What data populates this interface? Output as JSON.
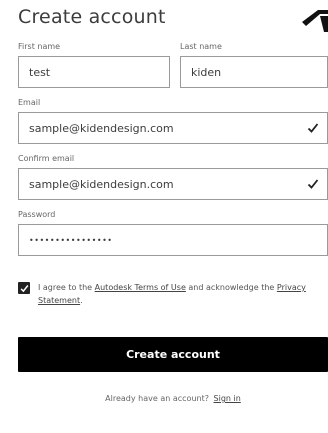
{
  "header": {
    "title": "Create account",
    "logo_icon": "autodesk-logo-icon"
  },
  "form": {
    "first_name": {
      "label": "First name",
      "value": "test"
    },
    "last_name": {
      "label": "Last name",
      "value": "kiden"
    },
    "email": {
      "label": "Email",
      "value": "sample@kidendesign.com",
      "valid_icon": "checkmark-icon"
    },
    "confirm_email": {
      "label": "Confirm email",
      "value": "sample@kidendesign.com",
      "valid_icon": "checkmark-icon"
    },
    "password": {
      "label": "Password",
      "value": "••••••••••••••••"
    }
  },
  "agreement": {
    "checked": true,
    "text_before": "I agree to the",
    "terms_link": "Autodesk Terms of Use",
    "text_middle": "and acknowledge the",
    "privacy_link": "Privacy Statement",
    "text_after": "."
  },
  "submit_label": "Create account",
  "footer": {
    "prompt": "Already have an account?",
    "signin_link": "Sign in"
  },
  "colors": {
    "button_bg": "#000000",
    "button_text": "#ffffff",
    "input_border": "#9a9a9a"
  }
}
